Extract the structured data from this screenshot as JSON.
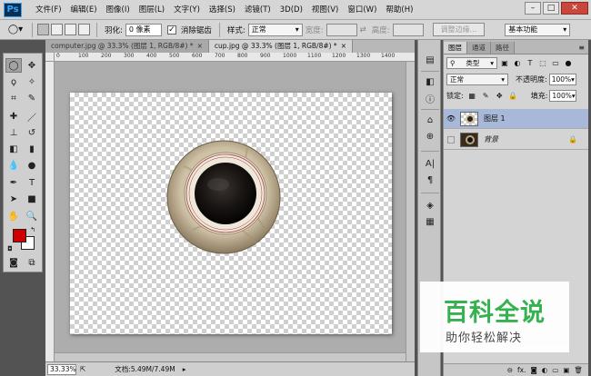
{
  "app": {
    "logo": "Ps"
  },
  "menu": [
    "文件(F)",
    "编辑(E)",
    "图像(I)",
    "图层(L)",
    "文字(Y)",
    "选择(S)",
    "滤镜(T)",
    "3D(D)",
    "视图(V)",
    "窗口(W)",
    "帮助(H)"
  ],
  "window_controls": {
    "minimize": "–",
    "maximize": "□",
    "close": "✕"
  },
  "options_bar": {
    "feather_label": "羽化:",
    "feather_value": "0 像素",
    "antialias_label": "消除锯齿",
    "antialias_checked": "✓",
    "style_label": "样式:",
    "style_value": "正常",
    "width_label": "宽度:",
    "height_label": "高度:",
    "swap_icon": "⇄",
    "refine_edge": "调整边缘...",
    "workspace": "基本功能"
  },
  "tabs": [
    {
      "label": "computer.jpg @ 33.3% (图层 1, RGB/8#) *",
      "close": "×"
    },
    {
      "label": "cup.jpg @ 33.3% (图层 1, RGB/8#) *",
      "close": "×"
    }
  ],
  "ruler_ticks": [
    "0",
    "100",
    "200",
    "300",
    "400",
    "500",
    "600",
    "700",
    "800",
    "900",
    "1000",
    "1100",
    "1200",
    "1300",
    "1400"
  ],
  "status": {
    "zoom": "33.33%",
    "doc_info": "文档:5.49M/7.49M"
  },
  "layers_panel": {
    "tabs": [
      "图层",
      "通道",
      "路径"
    ],
    "menu_icon": "≡",
    "filter_label": "类型",
    "blend_mode": "正常",
    "opacity_label": "不透明度:",
    "opacity_value": "100%",
    "lock_label": "锁定:",
    "fill_label": "填充:",
    "fill_value": "100%",
    "layers": [
      {
        "name": "图层 1",
        "selected": true
      },
      {
        "name": "背景",
        "locked": true
      }
    ],
    "footer_icons": [
      "⊖",
      "fx.",
      "◙",
      "◐",
      "▭",
      "▣",
      "🗑"
    ]
  },
  "watermark": {
    "title": "百科全说",
    "subtitle": "助你轻松解决"
  },
  "colors": {
    "foreground": "#d00000",
    "background": "#ffffff",
    "selected_layer": "#a7b8d8",
    "watermark_green": "#2fb14a"
  }
}
